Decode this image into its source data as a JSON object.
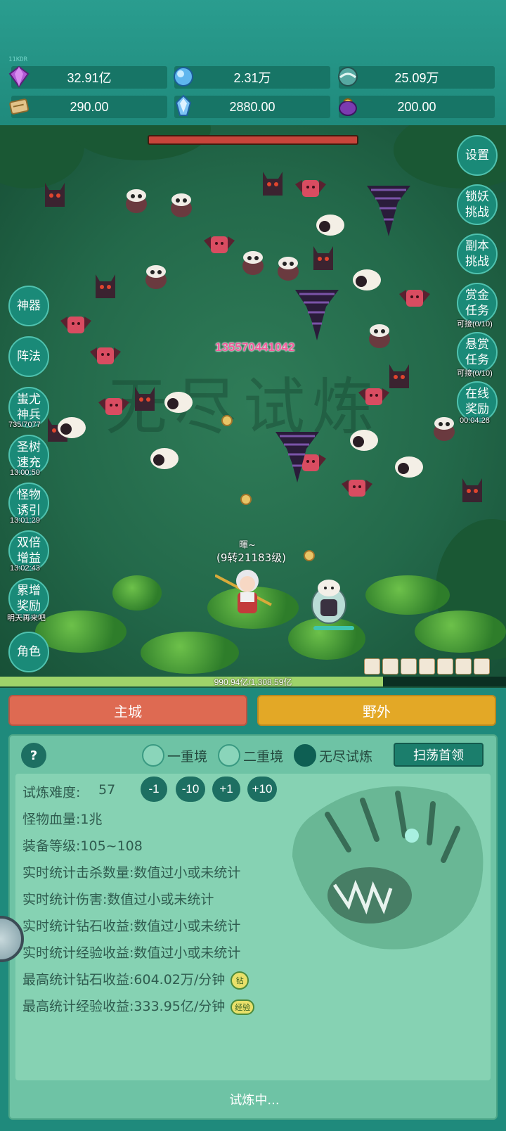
{
  "hud": {
    "fps": "11KDR",
    "resources": [
      {
        "icon": "purple-gem-icon",
        "value": "32.91亿"
      },
      {
        "icon": "blue-crystal-icon",
        "value": "2.31万"
      },
      {
        "icon": "spirit-orb-icon",
        "value": "25.09万"
      },
      {
        "icon": "scroll-icon",
        "value": "290.00"
      },
      {
        "icon": "ice-shard-icon",
        "value": "2880.00"
      },
      {
        "icon": "magic-pot-icon",
        "value": "200.00"
      }
    ]
  },
  "battle": {
    "watermark": "无尽试炼",
    "damage_number": "135570441042",
    "hero_name": "暉~",
    "hero_level": "(9转21183级)",
    "exp_text": "990.94亿/1,308.59亿",
    "exp_progress": 0.757
  },
  "left_buttons": [
    {
      "label": "神器",
      "sub": ""
    },
    {
      "label": "阵法",
      "sub": ""
    },
    {
      "label": "蚩尤神兵",
      "sub": "735/7077"
    },
    {
      "label": "圣树速充",
      "sub": "13:00:50"
    },
    {
      "label": "怪物诱引",
      "sub": "13:01:29"
    },
    {
      "label": "双倍增益",
      "sub": "13:02:43"
    },
    {
      "label": "累增奖励",
      "sub": "明天再来吧"
    },
    {
      "label": "角色",
      "sub": ""
    }
  ],
  "right_buttons": [
    {
      "label": "设置",
      "sub": ""
    },
    {
      "label": "锁妖挑战",
      "sub": ""
    },
    {
      "label": "副本挑战",
      "sub": ""
    },
    {
      "label": "赏金任务",
      "sub": "可接(0/10)"
    },
    {
      "label": "悬赏任务",
      "sub": "可接(0/10)"
    },
    {
      "label": "在线奖励",
      "sub": "00:04:28"
    }
  ],
  "tabs": {
    "main_city": "主城",
    "wild": "野外"
  },
  "trial": {
    "help": "?",
    "modes": [
      "一重境",
      "二重境",
      "无尽试炼"
    ],
    "selected_mode": "无尽试炼",
    "sweep_button": "扫荡首领",
    "difficulty_label": "试炼难度:",
    "difficulty_value": "57",
    "adjust": [
      "-1",
      "-10",
      "+1",
      "+10"
    ],
    "stats": [
      "怪物血量:1兆",
      "装备等级:105~108",
      "实时统计击杀数量:数值过小或未统计",
      "实时统计伤害:数值过小或未统计",
      "实时统计钻石收益:数值过小或未统计",
      "实时统计经验收益:数值过小或未统计"
    ],
    "best_diamond": "最高统计钻石收益:604.02万/分钟",
    "diamond_badge": "钻",
    "best_exp": "最高统计经验收益:333.95亿/分钟",
    "exp_badge": "经验",
    "status": "试炼中..."
  },
  "colors": {
    "main_city_tab": "#de6a52",
    "wild_tab": "#e3a826",
    "panel": "#6ec3a5",
    "frame": "#1f8a7c"
  }
}
